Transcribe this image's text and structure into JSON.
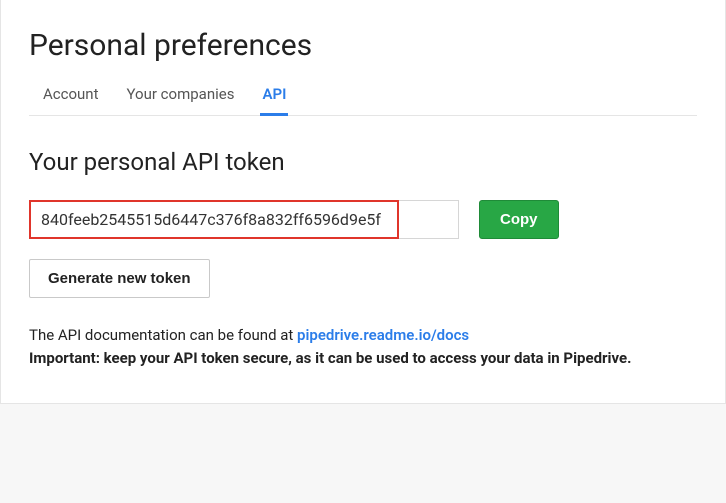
{
  "page": {
    "title": "Personal preferences"
  },
  "tabs": {
    "account": "Account",
    "companies": "Your companies",
    "api": "API"
  },
  "section": {
    "title": "Your personal API token",
    "token": "840feeb2545515d6447c376f8a832ff6596d9e5f",
    "copy_label": "Copy",
    "generate_label": "Generate new token",
    "doc_prefix": "The API documentation can be found at ",
    "doc_link": "pipedrive.readme.io/docs",
    "important": "Important: keep your API token secure, as it can be used to access your data in Pipedrive."
  }
}
